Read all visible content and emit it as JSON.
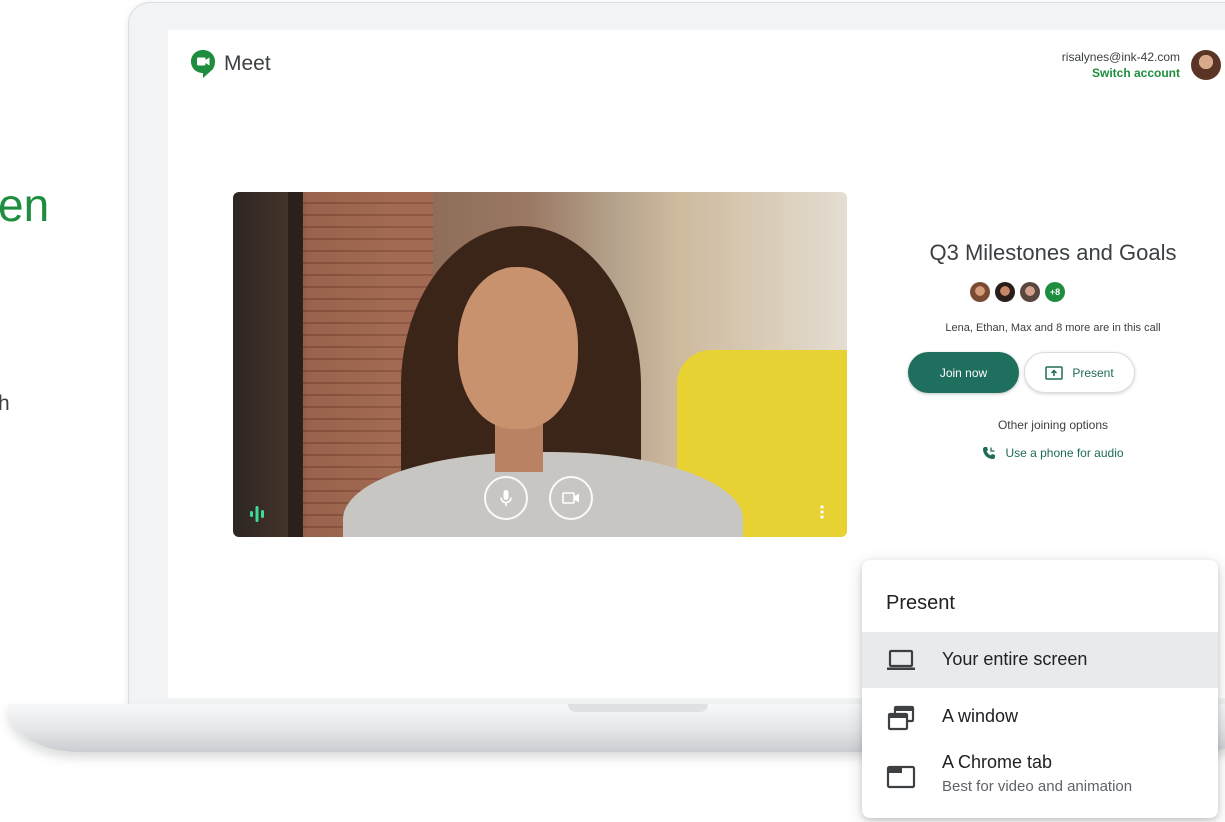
{
  "page": {
    "left_heading_fragment": "en",
    "left_body_fragment": "h"
  },
  "header": {
    "app_name": "Meet",
    "account_email": "risalynes@ink-42.com",
    "switch_account_label": "Switch account"
  },
  "meeting": {
    "title": "Q3 Milestones and Goals",
    "extra_participants_badge": "+8",
    "participants_text": "Lena, Ethan, Max and 8 more are in this call",
    "join_button_label": "Join now",
    "present_button_label": "Present",
    "other_options_label": "Other joining options",
    "phone_audio_link": "Use a phone for audio"
  },
  "present_menu": {
    "title": "Present",
    "items": [
      {
        "label": "Your entire screen",
        "icon": "laptop-icon"
      },
      {
        "label": "A window",
        "icon": "window-icon"
      },
      {
        "label": "A Chrome tab",
        "sublabel": "Best for video and animation",
        "icon": "tab-icon"
      }
    ]
  },
  "colors": {
    "brand_green": "#1e8e3e",
    "join_button": "#1f6f5e",
    "link_teal": "#1e6b58",
    "menu_highlight": "#e8eaed"
  }
}
